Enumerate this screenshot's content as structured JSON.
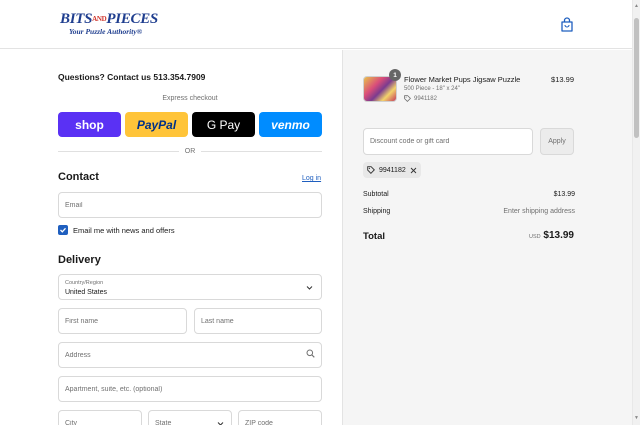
{
  "brand": {
    "name_part1": "BITS",
    "name_and": "AND",
    "name_part2": "PIECES",
    "tagline": "Your Puzzle Authority®"
  },
  "contact_line": "Questions? Contact us 513.354.7909",
  "express": {
    "label": "Express checkout",
    "buttons": {
      "shop": "shop",
      "paypal": "PayPal",
      "gpay": "G Pay",
      "venmo": "venmo"
    },
    "or": "OR"
  },
  "contact": {
    "title": "Contact",
    "login": "Log in",
    "email_placeholder": "Email",
    "newsletter_label": "Email me with news and offers",
    "newsletter_checked": true
  },
  "delivery": {
    "title": "Delivery",
    "country_label": "Country/Region",
    "country_value": "United States",
    "first_name_placeholder": "First name",
    "last_name_placeholder": "Last name",
    "address_placeholder": "Address",
    "apartment_placeholder": "Apartment, suite, etc. (optional)",
    "city_placeholder": "City",
    "state_placeholder": "State",
    "zip_placeholder": "ZIP code"
  },
  "order": {
    "item": {
      "quantity": "1",
      "name": "Flower Market Pups Jigsaw Puzzle",
      "variant": "500 Piece - 18\" x 24\"",
      "tag": "9941182",
      "price": "$13.99"
    },
    "discount_placeholder": "Discount code or gift card",
    "apply_label": "Apply",
    "applied_code": "9941182",
    "subtotal_label": "Subtotal",
    "subtotal_value": "$13.99",
    "shipping_label": "Shipping",
    "shipping_value": "Enter shipping address",
    "total_label": "Total",
    "currency": "USD",
    "total_value": "$13.99"
  },
  "colors": {
    "brand_blue": "#1f3e8f",
    "link_blue": "#1f5fbf",
    "shop_pay": "#5a31f4",
    "paypal": "#ffc439",
    "venmo": "#008cff"
  }
}
